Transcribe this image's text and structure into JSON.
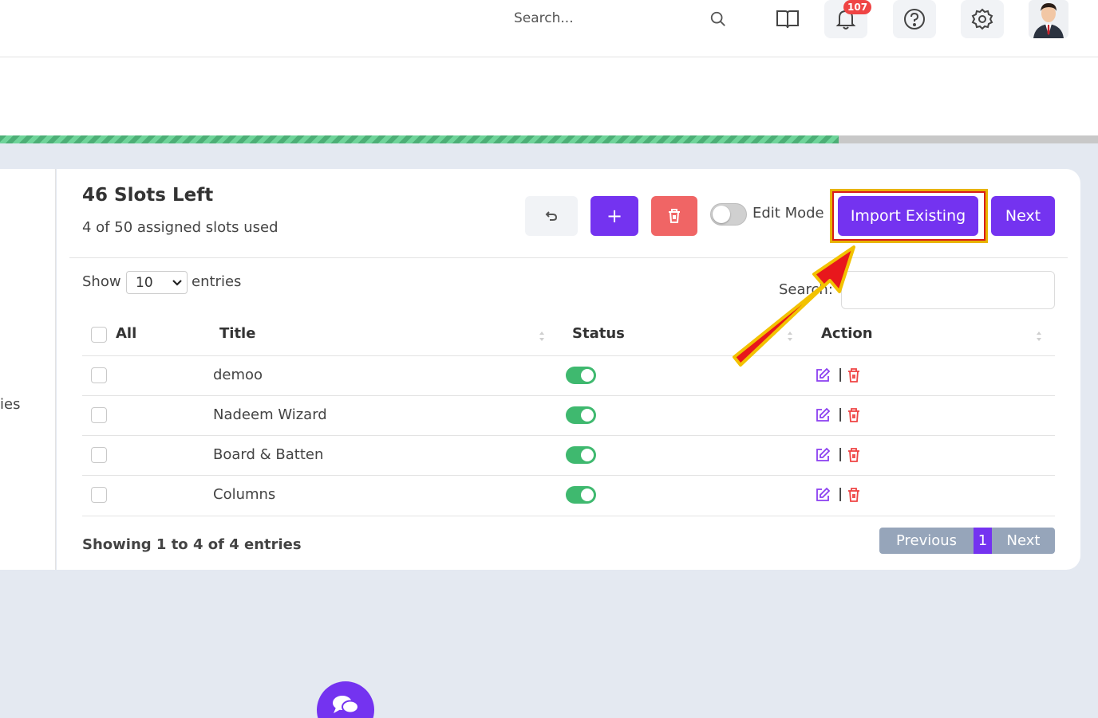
{
  "header": {
    "search_placeholder": "Search...",
    "notification_count": "107"
  },
  "card": {
    "title": "46 Slots Left",
    "subtitle": "4 of 50 assigned slots used",
    "add_label": "+",
    "edit_mode_label": "Edit Mode",
    "edit_mode_on": false,
    "import_label": "Import Existing",
    "next_label": "Next"
  },
  "progress": {
    "percent": 76.4
  },
  "sidebar": {
    "partial_text": "ies"
  },
  "table_controls": {
    "show_label": "Show",
    "entries_value": "10",
    "entries_label": "entries",
    "search_label": "Search:"
  },
  "table": {
    "headers": {
      "all": "All",
      "title": "Title",
      "status": "Status",
      "action": "Action"
    },
    "rows": [
      {
        "title": "demoo",
        "status_on": true
      },
      {
        "title": "Nadeem Wizard",
        "status_on": true
      },
      {
        "title": "Board & Batten",
        "status_on": true
      },
      {
        "title": "Columns",
        "status_on": true
      }
    ],
    "action_separator": "|"
  },
  "footer": {
    "showing": "Showing 1 to 4 of 4 entries",
    "pager": {
      "previous": "Previous",
      "current": "1",
      "next": "Next"
    }
  },
  "colors": {
    "primary": "#7433f0",
    "danger": "#f06565",
    "success": "#3fb96f",
    "pager_gray": "#96a5ba",
    "highlight_red": "#d81c1c",
    "highlight_yellow": "#e8b400"
  }
}
